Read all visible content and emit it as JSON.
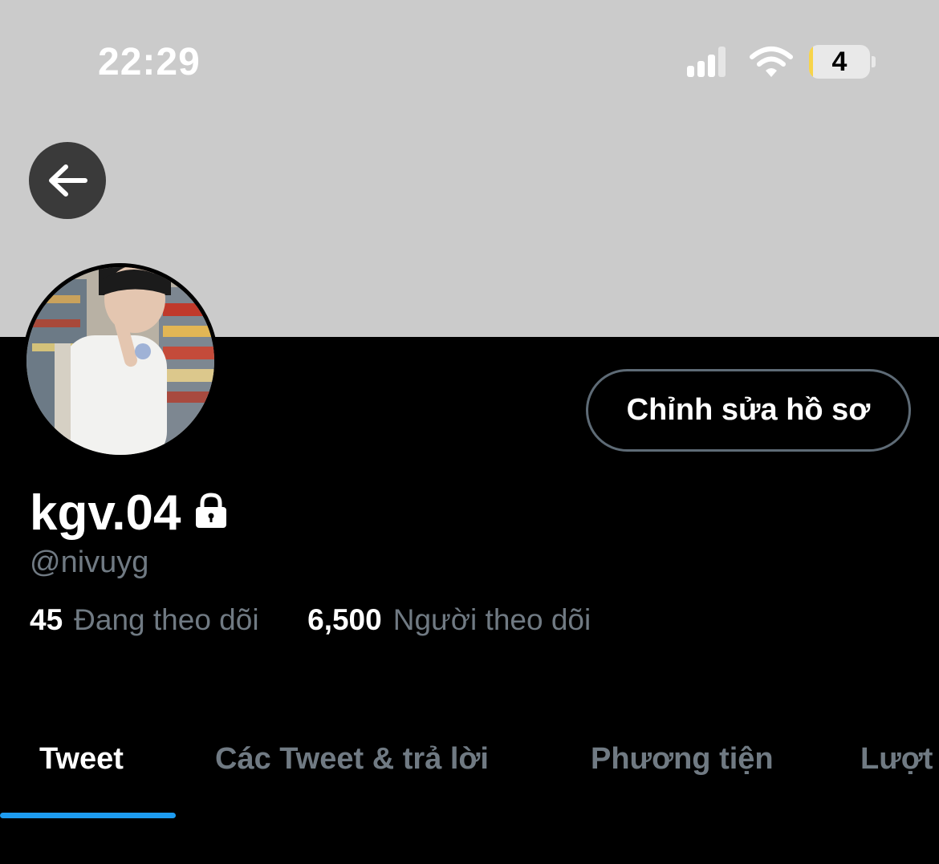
{
  "status_bar": {
    "time": "22:29",
    "battery_level": "4",
    "battery_fraction": 0.06,
    "signal_bars_filled": 3,
    "signal_bars_total": 4,
    "icons": [
      "signal-icon",
      "wifi-icon",
      "battery-icon"
    ]
  },
  "header": {
    "back_icon": "arrow-left-icon",
    "banner_color": "#cbcbcb"
  },
  "profile": {
    "avatar": "profile-photo",
    "edit_button_label": "Chỉnh sửa hồ sơ",
    "display_name": "kgv.04",
    "protected_icon": "lock-icon",
    "handle": "@nivuyg",
    "following_count": "45",
    "following_label": "Đang theo dõi",
    "followers_count": "6,500",
    "followers_label": "Người theo dõi"
  },
  "tabs": [
    {
      "label": "Tweet",
      "active": true
    },
    {
      "label": "Các Tweet & trả lời",
      "active": false
    },
    {
      "label": "Phương tiện",
      "active": false
    },
    {
      "label": "Lượt",
      "active": false
    }
  ],
  "colors": {
    "background": "#000000",
    "accent": "#1d9bf0",
    "secondary_text": "#707a83",
    "button_border": "#5e6b76"
  }
}
